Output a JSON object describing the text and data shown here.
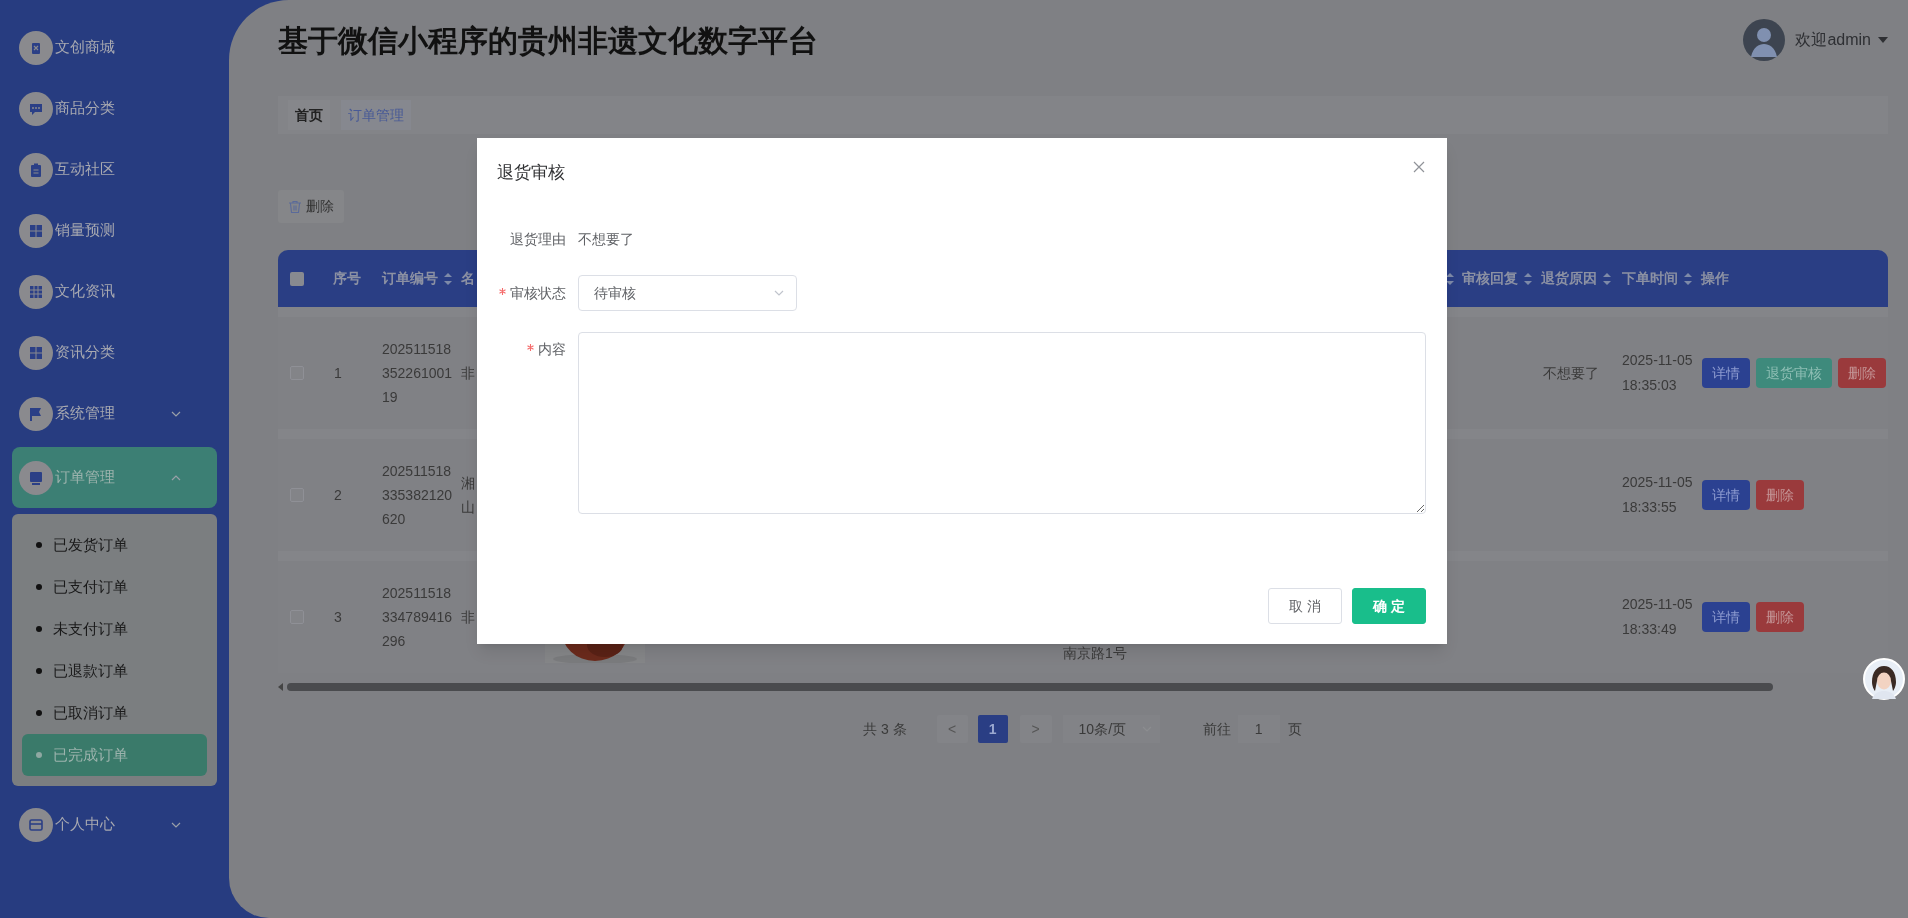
{
  "sidebar": {
    "items": [
      {
        "label": "文创商城",
        "kind": "link",
        "selected": false
      },
      {
        "label": "商品分类",
        "kind": "link",
        "selected": false
      },
      {
        "label": "互动社区",
        "kind": "link",
        "selected": false
      },
      {
        "label": "销量预测",
        "kind": "link",
        "selected": false
      },
      {
        "label": "文化资讯",
        "kind": "link",
        "selected": false
      },
      {
        "label": "资讯分类",
        "kind": "link",
        "selected": false
      },
      {
        "label": "系统管理",
        "kind": "group",
        "selected": false,
        "expanded": false
      },
      {
        "label": "订单管理",
        "kind": "group",
        "selected": true,
        "expanded": true,
        "children": [
          {
            "label": "已发货订单",
            "selected": false
          },
          {
            "label": "已支付订单",
            "selected": false
          },
          {
            "label": "未支付订单",
            "selected": false
          },
          {
            "label": "已退款订单",
            "selected": false
          },
          {
            "label": "已取消订单",
            "selected": false
          },
          {
            "label": "已完成订单",
            "selected": true
          }
        ]
      },
      {
        "label": "个人中心",
        "kind": "group",
        "selected": false,
        "expanded": false
      }
    ]
  },
  "header": {
    "title": "基于微信小程序的贵州非遗文化数字平台",
    "user": "欢迎admin"
  },
  "breadcrumb": [
    {
      "label": "首页",
      "kind": "home"
    },
    {
      "label": "订单管理",
      "kind": "link"
    }
  ],
  "toolbar": {
    "delete": "删除"
  },
  "table": {
    "all_checked": false,
    "columns": [
      {
        "label": "序号",
        "sortable": false
      },
      {
        "label": "订单编号",
        "sortable": true
      },
      {
        "label": "名",
        "sortable": false
      },
      {
        "sortable": true
      },
      {
        "label": "审核回复",
        "sortable": true
      },
      {
        "label": "退货原因",
        "sortable": true
      },
      {
        "label": "下单时间",
        "sortable": true
      },
      {
        "label": "操作",
        "sortable": false
      }
    ],
    "rows": [
      {
        "checked": false,
        "index": "1",
        "order_no": "20251151835226100119",
        "name": "非",
        "reason": "不想要了",
        "date": "2025-11-05",
        "time": "18:35:03",
        "actions": [
          {
            "label": "详情",
            "kind": "detail"
          },
          {
            "label": "退货审核",
            "kind": "review"
          },
          {
            "label": "删除",
            "kind": "delete"
          }
        ]
      },
      {
        "checked": false,
        "index": "2",
        "order_no": "202511518335382120620",
        "name": "湘山",
        "date": "2025-11-05",
        "time": "18:33:55",
        "actions": [
          {
            "label": "详情",
            "kind": "detail"
          },
          {
            "label": "删除",
            "kind": "delete"
          }
        ]
      },
      {
        "checked": false,
        "index": "3",
        "order_no": "202511518334789416296",
        "name": "非",
        "image": {
          "kind": "picture"
        },
        "address": "南京路1号",
        "date": "2025-11-05",
        "time": "18:33:49",
        "actions": [
          {
            "label": "详情",
            "kind": "detail"
          },
          {
            "label": "删除",
            "kind": "delete"
          }
        ]
      }
    ]
  },
  "pagination": {
    "total": "共 3 条",
    "prev": "<",
    "pages": [
      {
        "label": "1",
        "selected": true
      }
    ],
    "next": ">",
    "page_size": "10条/页",
    "goto_label": "前往",
    "goto_value": "1",
    "goto_suffix": "页"
  },
  "dialog": {
    "title": "退货审核",
    "fields": [
      {
        "label": "退货理由",
        "kind": "text",
        "value": "不想要了",
        "required": false
      },
      {
        "label": "审核状态",
        "kind": "select",
        "value": "待审核",
        "required": true
      },
      {
        "label": "内容",
        "kind": "textarea",
        "required": true
      }
    ],
    "buttons": [
      {
        "label": "取 消",
        "kind": "cancel"
      },
      {
        "label": "确 定",
        "kind": "primary"
      }
    ]
  }
}
